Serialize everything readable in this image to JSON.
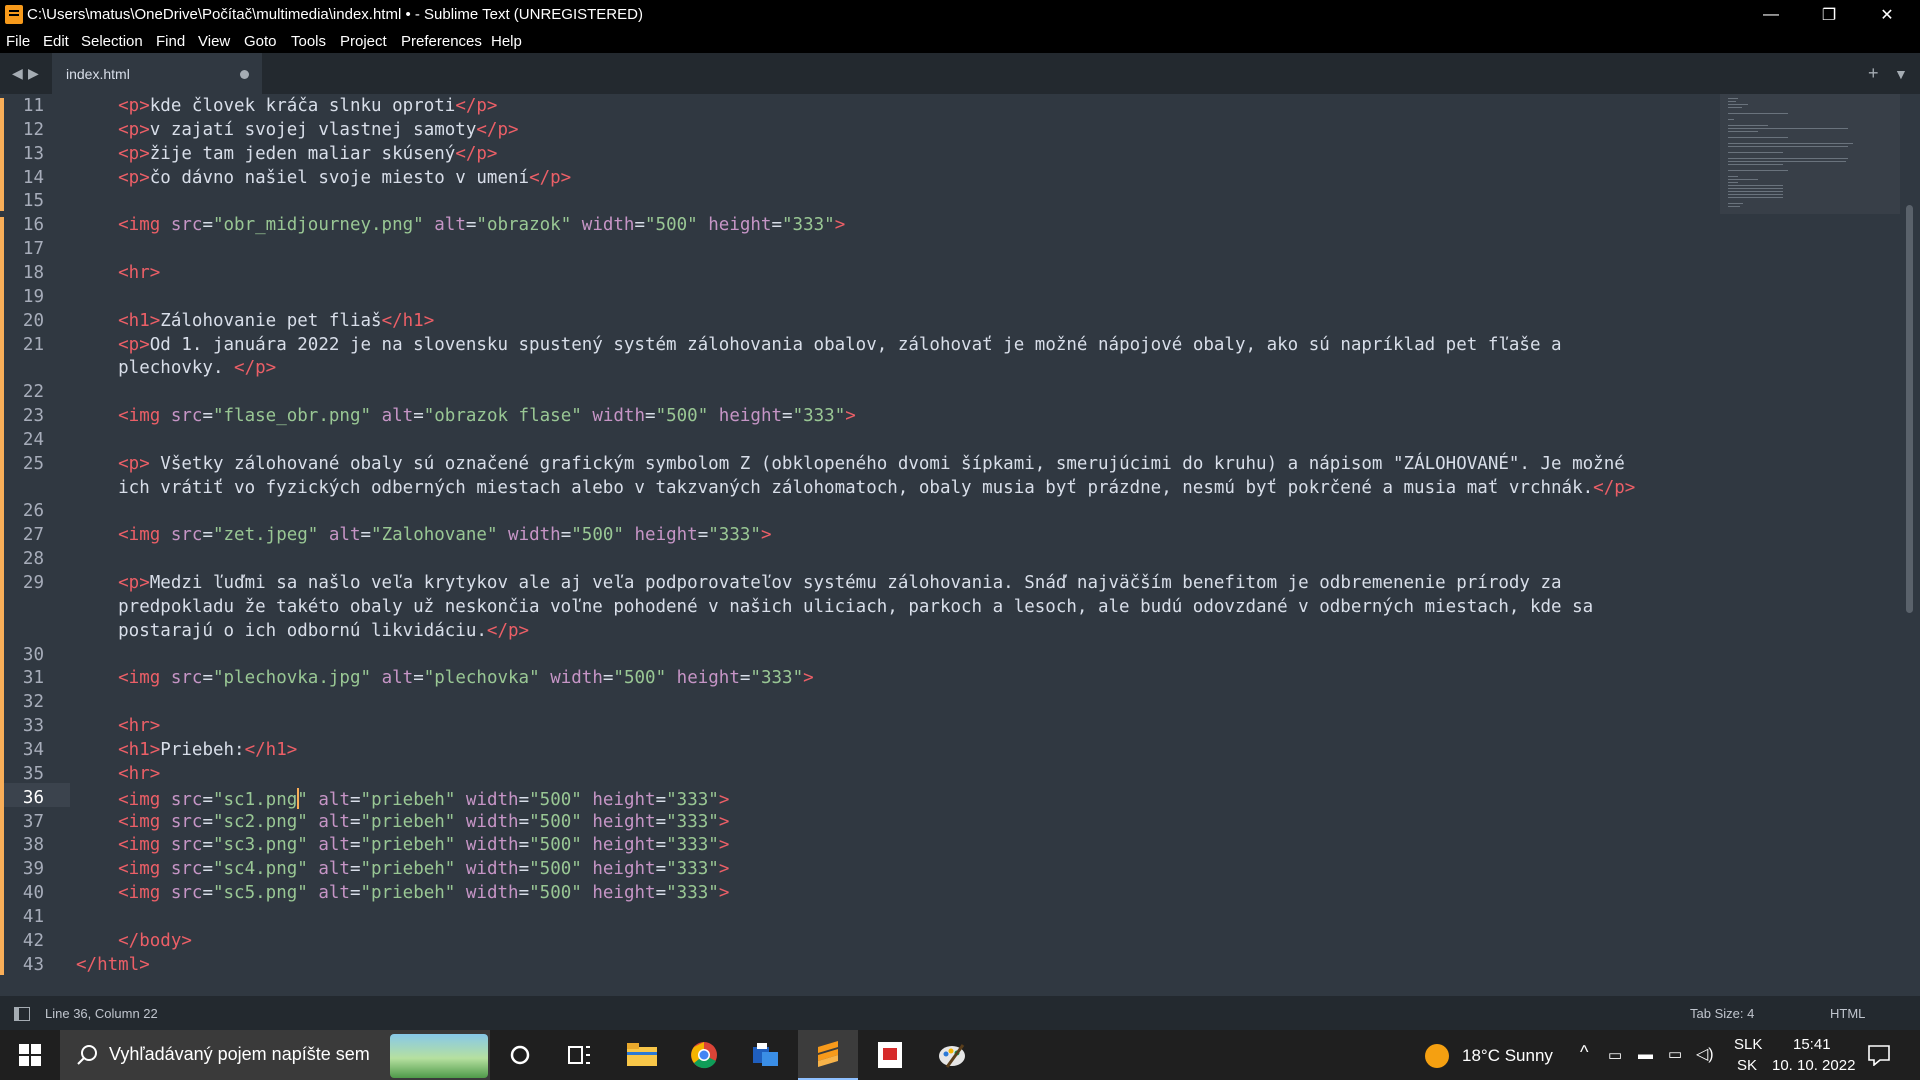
{
  "window": {
    "title": "C:\\Users\\matus\\OneDrive\\Počítač\\multimedia\\index.html • - Sublime Text (UNREGISTERED)",
    "controls": [
      "—",
      "❐",
      "✕"
    ]
  },
  "menu": [
    "File",
    "Edit",
    "Selection",
    "Find",
    "View",
    "Goto",
    "Tools",
    "Project",
    "Preferences",
    "Help"
  ],
  "tab": {
    "name": "index.html",
    "modified": true
  },
  "editor": {
    "lines": [
      {
        "n": "11",
        "tokens": [
          [
            "t",
            "    <p>"
          ],
          [
            "tx",
            "kde človek kráča slnku oproti"
          ],
          [
            "t",
            "</p>"
          ]
        ]
      },
      {
        "n": "12",
        "tokens": [
          [
            "t",
            "    <p>"
          ],
          [
            "tx",
            "v zajatí svojej vlastnej samoty"
          ],
          [
            "t",
            "</p>"
          ]
        ]
      },
      {
        "n": "13",
        "tokens": [
          [
            "t",
            "    <p>"
          ],
          [
            "tx",
            "žije tam jeden maliar skúsený"
          ],
          [
            "t",
            "</p>"
          ]
        ]
      },
      {
        "n": "14",
        "tokens": [
          [
            "t",
            "    <p>"
          ],
          [
            "tx",
            "čo dávno našiel svoje miesto v umení"
          ],
          [
            "t",
            "</p>"
          ]
        ]
      },
      {
        "n": "15",
        "tokens": []
      },
      {
        "n": "16",
        "tokens": [
          [
            "t",
            "    <img "
          ],
          [
            "a",
            "src"
          ],
          [
            "tx",
            "="
          ],
          [
            "s",
            "\"obr_midjourney.png\""
          ],
          [
            "tx",
            " "
          ],
          [
            "a",
            "alt"
          ],
          [
            "tx",
            "="
          ],
          [
            "s",
            "\"obrazok\""
          ],
          [
            "tx",
            " "
          ],
          [
            "a",
            "width"
          ],
          [
            "tx",
            "="
          ],
          [
            "s",
            "\"500\""
          ],
          [
            "tx",
            " "
          ],
          [
            "a",
            "height"
          ],
          [
            "tx",
            "="
          ],
          [
            "s",
            "\"333\""
          ],
          [
            "t",
            ">"
          ]
        ]
      },
      {
        "n": "17",
        "tokens": []
      },
      {
        "n": "18",
        "tokens": [
          [
            "t",
            "    <hr>"
          ]
        ]
      },
      {
        "n": "19",
        "tokens": []
      },
      {
        "n": "20",
        "tokens": [
          [
            "t",
            "    <h1>"
          ],
          [
            "tx",
            "Zálohovanie pet fliaš"
          ],
          [
            "t",
            "</h1>"
          ]
        ]
      },
      {
        "n": "21",
        "tokens": [
          [
            "t",
            "    <p>"
          ],
          [
            "tx",
            "Od 1. januára 2022 je na slovensku spustený systém zálohovania obalov, zálohovať je možné nápojové obaly, ako sú napríklad pet fľaše a"
          ]
        ]
      },
      {
        "n": "",
        "tokens": [
          [
            "tx",
            "    plechovky. "
          ],
          [
            "t",
            "</p>"
          ]
        ]
      },
      {
        "n": "22",
        "tokens": []
      },
      {
        "n": "23",
        "tokens": [
          [
            "t",
            "    <img "
          ],
          [
            "a",
            "src"
          ],
          [
            "tx",
            "="
          ],
          [
            "s",
            "\"flase_obr.png\""
          ],
          [
            "tx",
            " "
          ],
          [
            "a",
            "alt"
          ],
          [
            "tx",
            "="
          ],
          [
            "s",
            "\"obrazok flase\""
          ],
          [
            "tx",
            " "
          ],
          [
            "a",
            "width"
          ],
          [
            "tx",
            "="
          ],
          [
            "s",
            "\"500\""
          ],
          [
            "tx",
            " "
          ],
          [
            "a",
            "height"
          ],
          [
            "tx",
            "="
          ],
          [
            "s",
            "\"333\""
          ],
          [
            "t",
            ">"
          ]
        ]
      },
      {
        "n": "24",
        "tokens": []
      },
      {
        "n": "25",
        "tokens": [
          [
            "t",
            "    <p>"
          ],
          [
            "tx",
            " Všetky zálohované obaly sú označené grafickým symbolom Z (obklopeného dvomi šípkami, smerujúcimi do kruhu) a nápisom \"ZÁLOHOVANÉ\". Je možné"
          ]
        ]
      },
      {
        "n": "",
        "tokens": [
          [
            "tx",
            "    ich vrátiť vo fyzických odberných miestach alebo v takzvaných zálohomatoch, obaly musia byť prázdne, nesmú byť pokrčené a musia mať vrchnák."
          ],
          [
            "t",
            "</p>"
          ]
        ]
      },
      {
        "n": "26",
        "tokens": []
      },
      {
        "n": "27",
        "tokens": [
          [
            "t",
            "    <img "
          ],
          [
            "a",
            "src"
          ],
          [
            "tx",
            "="
          ],
          [
            "s",
            "\"zet.jpeg\""
          ],
          [
            "tx",
            " "
          ],
          [
            "a",
            "alt"
          ],
          [
            "tx",
            "="
          ],
          [
            "s",
            "\"Zalohovane\""
          ],
          [
            "tx",
            " "
          ],
          [
            "a",
            "width"
          ],
          [
            "tx",
            "="
          ],
          [
            "s",
            "\"500\""
          ],
          [
            "tx",
            " "
          ],
          [
            "a",
            "height"
          ],
          [
            "tx",
            "="
          ],
          [
            "s",
            "\"333\""
          ],
          [
            "t",
            ">"
          ]
        ]
      },
      {
        "n": "28",
        "tokens": []
      },
      {
        "n": "29",
        "tokens": [
          [
            "t",
            "    <p>"
          ],
          [
            "tx",
            "Medzi ľuďmi sa našlo veľa krytykov ale aj veľa podporovateľov systému zálohovania. Snáď najväčším benefitom je odbremenenie prírody za"
          ]
        ]
      },
      {
        "n": "",
        "tokens": [
          [
            "tx",
            "    predpokladu že takéto obaly už neskončia voľne pohodené v našich uliciach, parkoch a lesoch, ale budú odovzdané v odberných miestach, kde sa"
          ]
        ]
      },
      {
        "n": "",
        "tokens": [
          [
            "tx",
            "    postarajú o ich odbornú likvidáciu."
          ],
          [
            "t",
            "</p>"
          ]
        ]
      },
      {
        "n": "30",
        "tokens": []
      },
      {
        "n": "31",
        "tokens": [
          [
            "t",
            "    <img "
          ],
          [
            "a",
            "src"
          ],
          [
            "tx",
            "="
          ],
          [
            "s",
            "\"plechovka.jpg\""
          ],
          [
            "tx",
            " "
          ],
          [
            "a",
            "alt"
          ],
          [
            "tx",
            "="
          ],
          [
            "s",
            "\"plechovka\""
          ],
          [
            "tx",
            " "
          ],
          [
            "a",
            "width"
          ],
          [
            "tx",
            "="
          ],
          [
            "s",
            "\"500\""
          ],
          [
            "tx",
            " "
          ],
          [
            "a",
            "height"
          ],
          [
            "tx",
            "="
          ],
          [
            "s",
            "\"333\""
          ],
          [
            "t",
            ">"
          ]
        ]
      },
      {
        "n": "32",
        "tokens": []
      },
      {
        "n": "33",
        "tokens": [
          [
            "t",
            "    <hr>"
          ]
        ]
      },
      {
        "n": "34",
        "tokens": [
          [
            "t",
            "    <h1>"
          ],
          [
            "tx",
            "Priebeh:"
          ],
          [
            "t",
            "</h1>"
          ]
        ]
      },
      {
        "n": "35",
        "tokens": [
          [
            "t",
            "    <hr>"
          ]
        ]
      },
      {
        "n": "36",
        "active": true,
        "tokens": [
          [
            "t",
            "    <img "
          ],
          [
            "a",
            "src"
          ],
          [
            "tx",
            "="
          ],
          [
            "s",
            "\"sc1.png"
          ],
          [
            "cursor",
            ""
          ],
          [
            "s",
            "\""
          ],
          [
            "tx",
            " "
          ],
          [
            "a",
            "alt"
          ],
          [
            "tx",
            "="
          ],
          [
            "s",
            "\"priebeh\""
          ],
          [
            "tx",
            " "
          ],
          [
            "a",
            "width"
          ],
          [
            "tx",
            "="
          ],
          [
            "s",
            "\"500\""
          ],
          [
            "tx",
            " "
          ],
          [
            "a",
            "height"
          ],
          [
            "tx",
            "="
          ],
          [
            "s",
            "\"333\""
          ],
          [
            "t",
            ">"
          ]
        ]
      },
      {
        "n": "37",
        "tokens": [
          [
            "t",
            "    <img "
          ],
          [
            "a",
            "src"
          ],
          [
            "tx",
            "="
          ],
          [
            "s",
            "\"sc2.png\""
          ],
          [
            "tx",
            " "
          ],
          [
            "a",
            "alt"
          ],
          [
            "tx",
            "="
          ],
          [
            "s",
            "\"priebeh\""
          ],
          [
            "tx",
            " "
          ],
          [
            "a",
            "width"
          ],
          [
            "tx",
            "="
          ],
          [
            "s",
            "\"500\""
          ],
          [
            "tx",
            " "
          ],
          [
            "a",
            "height"
          ],
          [
            "tx",
            "="
          ],
          [
            "s",
            "\"333\""
          ],
          [
            "t",
            ">"
          ]
        ]
      },
      {
        "n": "38",
        "tokens": [
          [
            "t",
            "    <img "
          ],
          [
            "a",
            "src"
          ],
          [
            "tx",
            "="
          ],
          [
            "s",
            "\"sc3.png\""
          ],
          [
            "tx",
            " "
          ],
          [
            "a",
            "alt"
          ],
          [
            "tx",
            "="
          ],
          [
            "s",
            "\"priebeh\""
          ],
          [
            "tx",
            " "
          ],
          [
            "a",
            "width"
          ],
          [
            "tx",
            "="
          ],
          [
            "s",
            "\"500\""
          ],
          [
            "tx",
            " "
          ],
          [
            "a",
            "height"
          ],
          [
            "tx",
            "="
          ],
          [
            "s",
            "\"333\""
          ],
          [
            "t",
            ">"
          ]
        ]
      },
      {
        "n": "39",
        "tokens": [
          [
            "t",
            "    <img "
          ],
          [
            "a",
            "src"
          ],
          [
            "tx",
            "="
          ],
          [
            "s",
            "\"sc4.png\""
          ],
          [
            "tx",
            " "
          ],
          [
            "a",
            "alt"
          ],
          [
            "tx",
            "="
          ],
          [
            "s",
            "\"priebeh\""
          ],
          [
            "tx",
            " "
          ],
          [
            "a",
            "width"
          ],
          [
            "tx",
            "="
          ],
          [
            "s",
            "\"500\""
          ],
          [
            "tx",
            " "
          ],
          [
            "a",
            "height"
          ],
          [
            "tx",
            "="
          ],
          [
            "s",
            "\"333\""
          ],
          [
            "t",
            ">"
          ]
        ]
      },
      {
        "n": "40",
        "tokens": [
          [
            "t",
            "    <img "
          ],
          [
            "a",
            "src"
          ],
          [
            "tx",
            "="
          ],
          [
            "s",
            "\"sc5.png\""
          ],
          [
            "tx",
            " "
          ],
          [
            "a",
            "alt"
          ],
          [
            "tx",
            "="
          ],
          [
            "s",
            "\"priebeh\""
          ],
          [
            "tx",
            " "
          ],
          [
            "a",
            "width"
          ],
          [
            "tx",
            "="
          ],
          [
            "s",
            "\"500\""
          ],
          [
            "tx",
            " "
          ],
          [
            "a",
            "height"
          ],
          [
            "tx",
            "="
          ],
          [
            "s",
            "\"333\""
          ],
          [
            "t",
            ">"
          ]
        ]
      },
      {
        "n": "41",
        "tokens": []
      },
      {
        "n": "42",
        "tokens": [
          [
            "t",
            "    </"
          ],
          [
            "t2",
            "body"
          ],
          [
            "t",
            ">"
          ]
        ]
      },
      {
        "n": "43",
        "tokens": [
          [
            "t",
            "</"
          ],
          [
            "t2",
            "html"
          ],
          [
            "t",
            ">"
          ]
        ]
      }
    ]
  },
  "status": {
    "position": "Line 36, Column 22",
    "tab_size": "Tab Size: 4",
    "syntax": "HTML"
  },
  "taskbar": {
    "search_placeholder": "Vyhľadávaný pojem napíšte sem",
    "weather": "18°C  Sunny",
    "lang_top": "SLK",
    "lang_bottom": "SK",
    "time": "15:41",
    "date": "10. 10. 2022"
  },
  "colors": {
    "background": "#303841",
    "tag": "#ec5f67",
    "attribute": "#c695c6",
    "string": "#99c794",
    "text": "#d8dee9",
    "modified_marker": "#f9ae58"
  }
}
